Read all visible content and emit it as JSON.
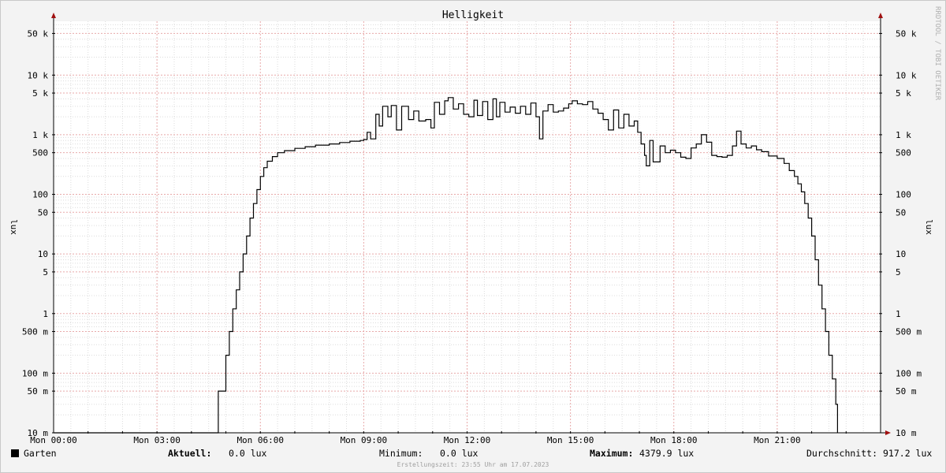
{
  "chart_data": {
    "type": "line",
    "title": "Helligkeit",
    "ylabel": "lux",
    "yscale": "log",
    "ylim": [
      0.01,
      80000
    ],
    "xlim": [
      "Mon 00:00",
      "Tue 00:00"
    ],
    "y_ticks": [
      {
        "value": 50000,
        "label": "50 k"
      },
      {
        "value": 10000,
        "label": "10 k"
      },
      {
        "value": 5000,
        "label": "5 k"
      },
      {
        "value": 1000,
        "label": "1 k"
      },
      {
        "value": 500,
        "label": "500"
      },
      {
        "value": 100,
        "label": "100"
      },
      {
        "value": 50,
        "label": "50"
      },
      {
        "value": 10,
        "label": "10"
      },
      {
        "value": 5,
        "label": "5"
      },
      {
        "value": 1,
        "label": "1"
      },
      {
        "value": 0.5,
        "label": "500 m"
      },
      {
        "value": 0.1,
        "label": "100 m"
      },
      {
        "value": 0.05,
        "label": "50 m"
      },
      {
        "value": 0.01,
        "label": "10 m"
      }
    ],
    "x_ticks": [
      {
        "hour": 0,
        "label": "Mon 00:00"
      },
      {
        "hour": 3,
        "label": "Mon 03:00"
      },
      {
        "hour": 6,
        "label": "Mon 06:00"
      },
      {
        "hour": 9,
        "label": "Mon 09:00"
      },
      {
        "hour": 12,
        "label": "Mon 12:00"
      },
      {
        "hour": 15,
        "label": "Mon 15:00"
      },
      {
        "hour": 18,
        "label": "Mon 18:00"
      },
      {
        "hour": 21,
        "label": "Mon 21:00"
      }
    ],
    "grid": true,
    "series": [
      {
        "name": "Garten",
        "color": "#000000",
        "points": [
          [
            0,
            0
          ],
          [
            4.75,
            0
          ],
          [
            4.78,
            0.05
          ],
          [
            4.9,
            0.05
          ],
          [
            5.0,
            0.2
          ],
          [
            5.1,
            0.5
          ],
          [
            5.2,
            1.2
          ],
          [
            5.3,
            2.5
          ],
          [
            5.4,
            5
          ],
          [
            5.5,
            10
          ],
          [
            5.6,
            20
          ],
          [
            5.7,
            40
          ],
          [
            5.8,
            70
          ],
          [
            5.9,
            120
          ],
          [
            6.0,
            200
          ],
          [
            6.1,
            280
          ],
          [
            6.2,
            360
          ],
          [
            6.35,
            430
          ],
          [
            6.5,
            500
          ],
          [
            6.7,
            540
          ],
          [
            7.0,
            590
          ],
          [
            7.3,
            630
          ],
          [
            7.6,
            670
          ],
          [
            8.0,
            700
          ],
          [
            8.3,
            740
          ],
          [
            8.6,
            780
          ],
          [
            8.9,
            800
          ],
          [
            9.0,
            830
          ],
          [
            9.1,
            1100
          ],
          [
            9.2,
            850
          ],
          [
            9.35,
            2200
          ],
          [
            9.45,
            1400
          ],
          [
            9.55,
            3000
          ],
          [
            9.7,
            2000
          ],
          [
            9.8,
            3100
          ],
          [
            9.95,
            1200
          ],
          [
            10.1,
            3000
          ],
          [
            10.3,
            1800
          ],
          [
            10.45,
            2500
          ],
          [
            10.6,
            1700
          ],
          [
            10.8,
            1800
          ],
          [
            10.95,
            1300
          ],
          [
            11.05,
            3500
          ],
          [
            11.2,
            2200
          ],
          [
            11.35,
            3700
          ],
          [
            11.45,
            4200
          ],
          [
            11.6,
            2700
          ],
          [
            11.75,
            3300
          ],
          [
            11.9,
            2200
          ],
          [
            12.05,
            2000
          ],
          [
            12.2,
            3800
          ],
          [
            12.3,
            2100
          ],
          [
            12.45,
            3600
          ],
          [
            12.6,
            1800
          ],
          [
            12.75,
            4000
          ],
          [
            12.85,
            2000
          ],
          [
            12.95,
            3500
          ],
          [
            13.1,
            2400
          ],
          [
            13.25,
            2900
          ],
          [
            13.4,
            2300
          ],
          [
            13.55,
            3000
          ],
          [
            13.7,
            2200
          ],
          [
            13.85,
            3400
          ],
          [
            14.0,
            2000
          ],
          [
            14.1,
            850
          ],
          [
            14.2,
            2500
          ],
          [
            14.35,
            3200
          ],
          [
            14.5,
            2400
          ],
          [
            14.65,
            2500
          ],
          [
            14.8,
            2800
          ],
          [
            14.95,
            3300
          ],
          [
            15.05,
            3700
          ],
          [
            15.2,
            3300
          ],
          [
            15.35,
            3200
          ],
          [
            15.5,
            3600
          ],
          [
            15.65,
            2700
          ],
          [
            15.8,
            2300
          ],
          [
            15.95,
            1800
          ],
          [
            16.1,
            1200
          ],
          [
            16.25,
            2600
          ],
          [
            16.4,
            1300
          ],
          [
            16.55,
            2200
          ],
          [
            16.7,
            1400
          ],
          [
            16.85,
            1700
          ],
          [
            16.95,
            1100
          ],
          [
            17.05,
            700
          ],
          [
            17.15,
            450
          ],
          [
            17.2,
            300
          ],
          [
            17.3,
            800
          ],
          [
            17.4,
            350
          ],
          [
            17.5,
            350
          ],
          [
            17.6,
            650
          ],
          [
            17.75,
            500
          ],
          [
            17.9,
            550
          ],
          [
            18.05,
            500
          ],
          [
            18.2,
            420
          ],
          [
            18.35,
            400
          ],
          [
            18.5,
            600
          ],
          [
            18.65,
            700
          ],
          [
            18.8,
            1000
          ],
          [
            18.95,
            750
          ],
          [
            19.1,
            450
          ],
          [
            19.25,
            430
          ],
          [
            19.4,
            420
          ],
          [
            19.55,
            450
          ],
          [
            19.7,
            650
          ],
          [
            19.82,
            1150
          ],
          [
            19.95,
            700
          ],
          [
            20.1,
            600
          ],
          [
            20.25,
            650
          ],
          [
            20.4,
            560
          ],
          [
            20.55,
            520
          ],
          [
            20.75,
            440
          ],
          [
            21.0,
            400
          ],
          [
            21.2,
            330
          ],
          [
            21.35,
            250
          ],
          [
            21.5,
            200
          ],
          [
            21.6,
            150
          ],
          [
            21.7,
            110
          ],
          [
            21.8,
            70
          ],
          [
            21.9,
            40
          ],
          [
            22.0,
            20
          ],
          [
            22.1,
            8
          ],
          [
            22.2,
            3
          ],
          [
            22.3,
            1.2
          ],
          [
            22.4,
            0.5
          ],
          [
            22.5,
            0.2
          ],
          [
            22.6,
            0.08
          ],
          [
            22.7,
            0.03
          ],
          [
            22.75,
            0
          ]
        ]
      }
    ]
  },
  "legend": {
    "series_label": "Garten",
    "current_label": "Aktuell:",
    "current_value": "0.0 lux",
    "min_label": "Minimum:",
    "min_value": "0.0 lux",
    "max_label": "Maximum:",
    "max_value": "4379.9 lux",
    "avg_label": "Durchschnitt:",
    "avg_value": "917.2 lux"
  },
  "footer": "Erstellungszeit: 23:55 Uhr am 17.07.2023",
  "side_text": "RRDTOOL / TOBI OETIKER",
  "colors": {
    "background": "#f3f3f3",
    "plot_area": "#ffffff",
    "major_grid": "#e8a9a9",
    "minor_grid": "#dcdcdc",
    "axis_arrow": "#a01010",
    "line": "#000000"
  }
}
